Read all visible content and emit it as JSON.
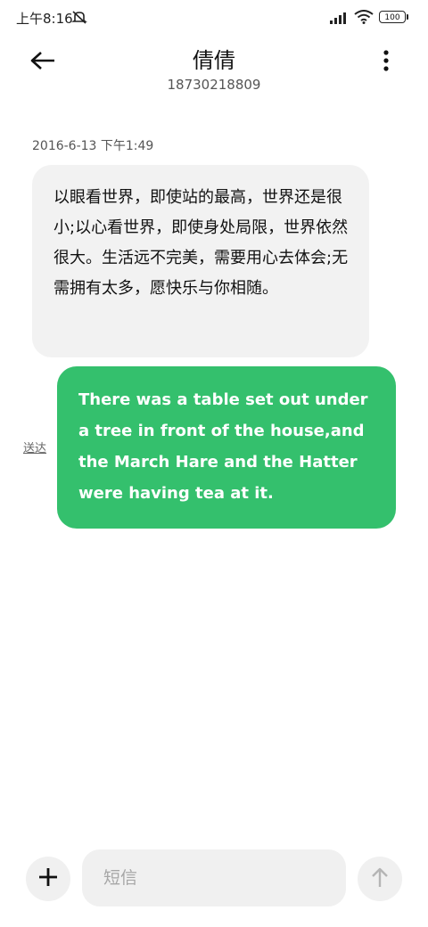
{
  "status_bar": {
    "time": "上午8:16",
    "battery": "100"
  },
  "header": {
    "contact_name": "倩倩",
    "contact_number": "18730218809"
  },
  "conversation": {
    "timestamp": "2016-6-13 下午1:49",
    "incoming_message": "以眼看世界，即使站的最高，世界还是很小;以心看世界，即使身处局限，世界依然很大。生活远不完美，需要用心去体会;无需拥有太多，愿快乐与你相随。",
    "outgoing_message": "There was a table set out under a tree in front of the house,and the March Hare and the Hatter were having tea at it.",
    "delivery_status": "送达"
  },
  "input_bar": {
    "placeholder": "短信",
    "value": ""
  },
  "colors": {
    "outgoing_bubble": "#34c06d",
    "incoming_bubble": "#f2f2f2"
  }
}
